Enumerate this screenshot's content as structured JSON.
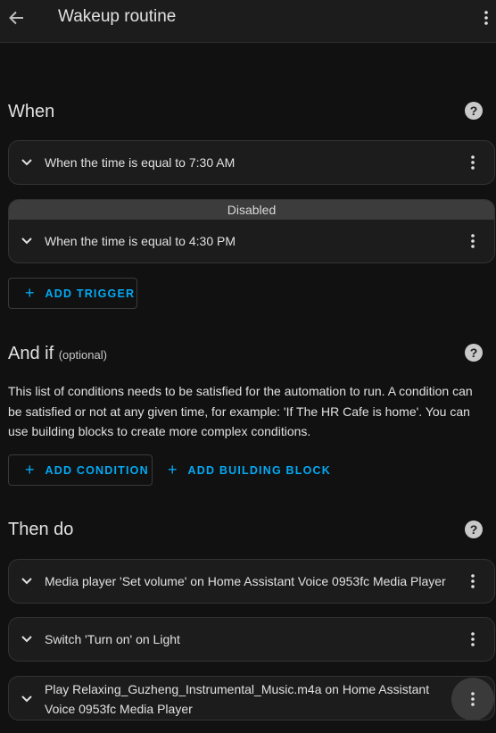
{
  "header": {
    "title": "Wakeup routine",
    "back_icon": "arrow-left-icon",
    "menu_icon": "dots-vertical-icon"
  },
  "when": {
    "title": "When",
    "triggers": [
      {
        "label": "When the time is equal to 7:30 AM",
        "disabled": false
      },
      {
        "label": "When the time is equal to 4:30 PM",
        "disabled": true,
        "banner": "Disabled"
      }
    ],
    "add_label": "ADD TRIGGER"
  },
  "and_if": {
    "title": "And if",
    "optional": "(optional)",
    "description": "This list of conditions needs to be satisfied for the automation to run. A condition can be satisfied or not at any given time, for example: 'If The HR Cafe is home'. You can use building blocks to create more complex conditions.",
    "add_condition_label": "ADD CONDITION",
    "add_block_label": "ADD BUILDING BLOCK"
  },
  "then_do": {
    "title": "Then do",
    "actions": [
      {
        "label": "Media player 'Set volume' on Home Assistant Voice 0953fc Media Player"
      },
      {
        "label": "Switch 'Turn on' on Light"
      },
      {
        "label": "Play Relaxing_Guzheng_Instrumental_Music.m4a on Home Assistant Voice 0953fc Media Player"
      }
    ]
  },
  "colors": {
    "accent": "#03a9f4",
    "background": "#111111",
    "card": "#1c1c1c"
  }
}
